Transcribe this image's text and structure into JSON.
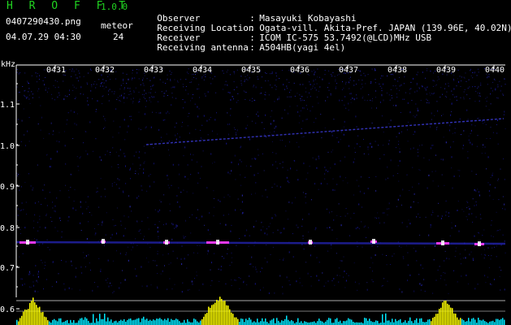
{
  "header": {
    "app_title": "H R O F F T",
    "app_version": "1.0.0",
    "file_name": "0407290430.png",
    "timestamp": "04.07.29 04:30",
    "meteor_label": "meteor",
    "meteor_count": "24"
  },
  "info": [
    {
      "key": "Observer",
      "value": "Masayuki Kobayashi"
    },
    {
      "key": "Receiving Location",
      "value": "Ogata-vill. Akita-Pref. JAPAN (139.96E, 40.02N)"
    },
    {
      "key": "Receiver",
      "value": "ICOM IC-575 53.7492(@LCD)MHz USB"
    },
    {
      "key": "Receiving antenna",
      "value": "A504HB(yagi 4el)"
    }
  ],
  "axis": {
    "unit": "kHz",
    "time_labels": [
      "0431",
      "0432",
      "0433",
      "0434",
      "0435",
      "0436",
      "0437",
      "0438",
      "0439",
      "0440"
    ],
    "freq_labels": [
      "1.1",
      "1.0",
      "0.9",
      "0.8",
      "0.7",
      "0.6"
    ]
  },
  "colors": {
    "background": "#000000",
    "title_green": "#21d421",
    "noise_blue": "#1a1aa8",
    "signal_magenta": "#ff3cff",
    "bar_yellow": "#ffff00",
    "bar_cyan": "#00e8ff"
  }
}
